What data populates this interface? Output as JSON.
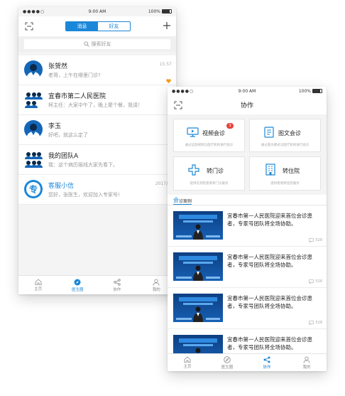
{
  "phone_left": {
    "status": {
      "carrier": "●●●●○",
      "time": "9:00 AM",
      "battery": "100%"
    },
    "segments": [
      {
        "label": "消息",
        "active": true
      },
      {
        "label": "好友",
        "active": false
      }
    ],
    "search": {
      "placeholder": "搜索好友"
    },
    "chats": [
      {
        "name": "张贺然",
        "message": "老哥，上午在哪里门诊?",
        "time": "15:57",
        "favorite": true,
        "avatar": "doctor"
      },
      {
        "name": "宜春市第二人民医院",
        "message": "柯主任：大家中午了，晚上聚个餐，我请！",
        "time": "",
        "favorite": false,
        "avatar": "group"
      },
      {
        "name": "李玉",
        "message": "好吧，就这么定了",
        "time": "",
        "favorite": false,
        "avatar": "doctor"
      },
      {
        "name": "我的团队A",
        "message": "我：这个病历报线大家先看下。",
        "time": "",
        "favorite": false,
        "avatar": "group"
      },
      {
        "name": "客服小信",
        "message": "您好，张医生，欢迎加入专家号!",
        "time": "2017/3/",
        "favorite": false,
        "avatar": "service"
      }
    ],
    "tabs": [
      {
        "label": "主页",
        "icon": "home-icon",
        "active": false
      },
      {
        "label": "医生圈",
        "icon": "compass-icon",
        "active": true
      },
      {
        "label": "协作",
        "icon": "share-icon",
        "active": false
      },
      {
        "label": "我的",
        "icon": "user-icon",
        "active": false
      }
    ]
  },
  "phone_right": {
    "status": {
      "carrier": "●●●●○",
      "time": "9:00 AM",
      "battery": "100%"
    },
    "title": "协作",
    "cards": [
      {
        "label": "视频会诊",
        "sub": "通过远程视频与医疗机构进行会诊",
        "icon": "video-icon",
        "badge": "3"
      },
      {
        "label": "图文会诊",
        "sub": "通过图文模式与医疗机构进行会诊",
        "icon": "document-icon",
        "badge": ""
      },
      {
        "label": "转门诊",
        "sub": "提供实到院患者转门诊服务",
        "icon": "cross-icon",
        "badge": ""
      },
      {
        "label": "转住院",
        "sub": "提供患者转住院服务",
        "icon": "building-icon",
        "badge": ""
      }
    ],
    "section": {
      "big": "会",
      "rest": "诊案例"
    },
    "cases": [
      {
        "text": "宜春市第一人民医院迎来首位会诊患者，专家号团队将全场协助。",
        "count": "528"
      },
      {
        "text": "宜春市第一人民医院迎来首位会诊患者，专家号团队将全场协助。",
        "count": "528"
      },
      {
        "text": "宜春市第一人民医院迎来首位会诊患者，专家号团队将全场协助。",
        "count": "528"
      },
      {
        "text": "宜春市第一人民医院迎来首位会诊患者，专家号团队将全场协助。",
        "count": "528"
      }
    ],
    "tabs": [
      {
        "label": "主页",
        "icon": "home-icon",
        "active": false
      },
      {
        "label": "医生圈",
        "icon": "compass-icon",
        "active": false
      },
      {
        "label": "协作",
        "icon": "share-icon",
        "active": true
      },
      {
        "label": "我的",
        "icon": "user-icon",
        "active": false
      }
    ]
  },
  "colors": {
    "accent": "#1b87d8",
    "badge": "#e8413c",
    "favorite": "#f0a020"
  }
}
